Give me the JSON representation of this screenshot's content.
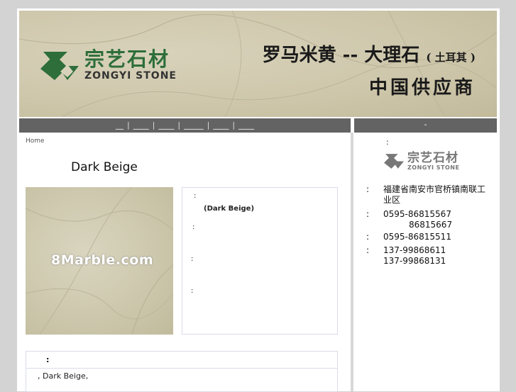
{
  "header": {
    "logo_cn": "宗艺石材",
    "logo_en": "ZONGYI STONE",
    "title_main": "罗马米黄 -- 大理石",
    "title_paren": "( 土耳其 )",
    "subtitle": "中国供应商"
  },
  "nav": {
    "items": [
      "__",
      "____",
      "____",
      "_____",
      "____",
      "____"
    ],
    "side_label": "-"
  },
  "breadcrumb": "Home",
  "product": {
    "title": "Dark Beige",
    "image_watermark": "8Marble.com",
    "info_rows": [
      {
        "label": ":",
        "value": "(Dark Beige)"
      },
      {
        "label": ":",
        "value": ""
      },
      {
        "label": ":",
        "value": ""
      },
      {
        "label": ":",
        "value": ""
      }
    ]
  },
  "description": {
    "header": ":",
    "body": ", Dark Beige,"
  },
  "sidebar": {
    "heading": ":",
    "logo_cn": "宗艺石材",
    "logo_en": "ZONGYI STONE",
    "contacts": [
      {
        "label": ":",
        "lines": [
          "福建省南安市官桥镇南联工业区"
        ]
      },
      {
        "label": ":",
        "lines": [
          "0595-86815567",
          "86815667"
        ]
      },
      {
        "label": ":",
        "lines": [
          "0595-86815511"
        ]
      },
      {
        "label": ":",
        "lines": [
          "137-99868611",
          "137-99868131"
        ]
      }
    ]
  },
  "colors": {
    "brand_green": "#2d6e3a",
    "nav_gray": "#636363",
    "border": "#d9dbea"
  }
}
